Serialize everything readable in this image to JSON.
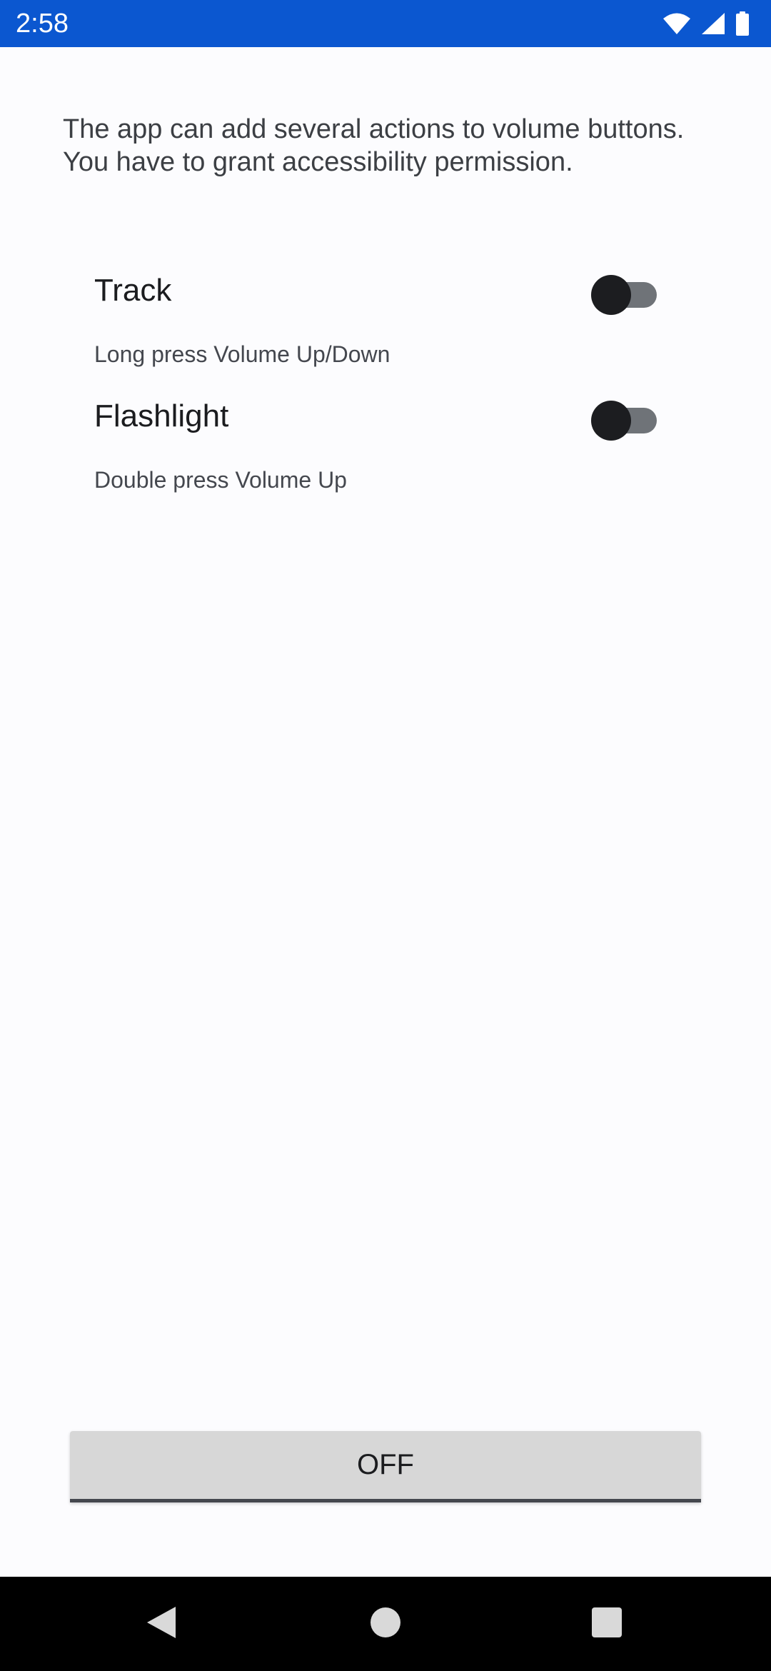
{
  "status_bar": {
    "time": "2:58",
    "icons": [
      "wifi-icon",
      "signal-icon",
      "battery-icon"
    ],
    "background": "#0b57d0"
  },
  "intro": {
    "line1": "The app can add several actions to volume buttons.",
    "line2": "You have to grant accessibility permission."
  },
  "settings": [
    {
      "title": "Track",
      "description": "Long press Volume Up/Down",
      "enabled": false
    },
    {
      "title": "Flashlight",
      "description": "Double press Volume Up",
      "enabled": false
    }
  ],
  "main_button": {
    "label": "OFF"
  },
  "nav_bar": {
    "buttons": [
      "back-icon",
      "home-icon",
      "recents-icon"
    ]
  }
}
